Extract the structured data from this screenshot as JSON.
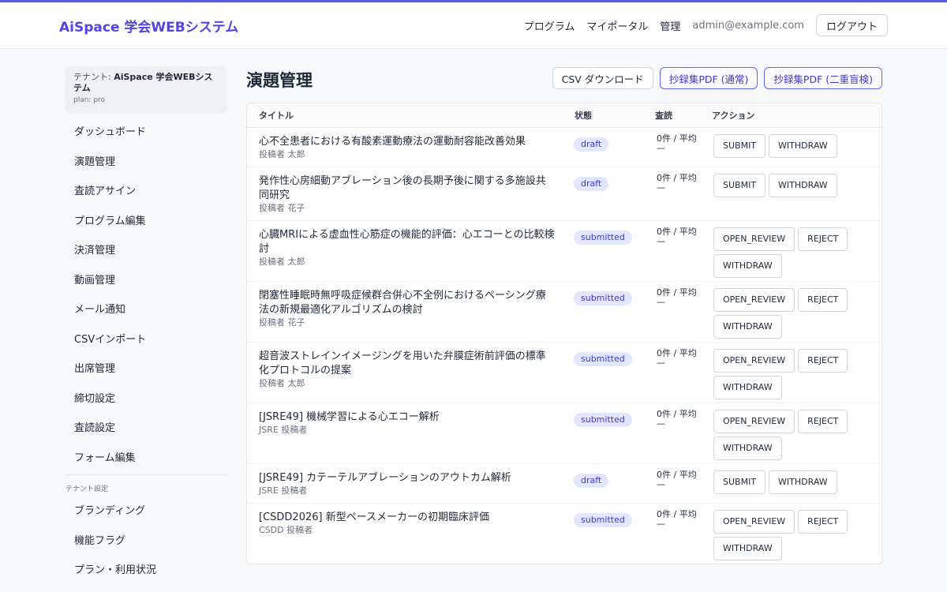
{
  "app": {
    "brand": "AiSpace 学会WEBシステム",
    "accent_color": "#4f46e5"
  },
  "header": {
    "nav": [
      "プログラム",
      "マイポータル",
      "管理"
    ],
    "email": "admin@example.com",
    "logout_label": "ログアウト"
  },
  "sidebar": {
    "tenant_prefix": "テナント: ",
    "tenant_name": "AiSpace 学会WEBシステム",
    "plan": "plan: pro",
    "items": [
      "ダッシュボード",
      "演題管理",
      "査読アサイン",
      "プログラム編集",
      "決済管理",
      "動画管理",
      "メール通知",
      "CSVインポート",
      "出席管理",
      "締切設定",
      "査読設定",
      "フォーム編集"
    ],
    "section_label": "テナント設定",
    "settings_items": [
      "ブランディング",
      "機能フラグ",
      "プラン・利用状況"
    ]
  },
  "main": {
    "title": "演題管理",
    "csv_button": "CSV ダウンロード",
    "pdf_normal_button": "抄録集PDF (通常)",
    "pdf_blind_button": "抄録集PDF (二重盲検)",
    "columns": [
      "タイトル",
      "状態",
      "査読",
      "アクション"
    ],
    "rows": [
      {
        "title": "心不全患者における有酸素運動療法の運動耐容能改善効果",
        "author": "投稿者 太郎",
        "status": "draft",
        "review": "0件 / 平均 —",
        "actions": [
          "SUBMIT",
          "WITHDRAW"
        ]
      },
      {
        "title": "発作性心房細動アブレーション後の長期予後に関する多施設共同研究",
        "author": "投稿者 花子",
        "status": "draft",
        "review": "0件 / 平均 —",
        "actions": [
          "SUBMIT",
          "WITHDRAW"
        ]
      },
      {
        "title": "心臓MRIによる虚血性心筋症の機能的評価：心エコーとの比較検討",
        "author": "投稿者 太郎",
        "status": "submitted",
        "review": "0件 / 平均 —",
        "actions": [
          "OPEN_REVIEW",
          "REJECT",
          "WITHDRAW"
        ]
      },
      {
        "title": "閉塞性睡眠時無呼吸症候群合併心不全例におけるペーシング療法の新規最適化アルゴリズムの検討",
        "author": "投稿者 花子",
        "status": "submitted",
        "review": "0件 / 平均 —",
        "actions": [
          "OPEN_REVIEW",
          "REJECT",
          "WITHDRAW"
        ]
      },
      {
        "title": "超音波ストレインイメージングを用いた弁膜症術前評価の標準化プロトコルの提案",
        "author": "投稿者 太郎",
        "status": "submitted",
        "review": "0件 / 平均 —",
        "actions": [
          "OPEN_REVIEW",
          "REJECT",
          "WITHDRAW"
        ]
      },
      {
        "title": "[JSRE49] 機械学習による心エコー解析",
        "author": "JSRE 投稿者",
        "status": "submitted",
        "review": "0件 / 平均 —",
        "actions": [
          "OPEN_REVIEW",
          "REJECT",
          "WITHDRAW"
        ]
      },
      {
        "title": "[JSRE49] カテーテルアブレーションのアウトカム解析",
        "author": "JSRE 投稿者",
        "status": "draft",
        "review": "0件 / 平均 —",
        "actions": [
          "SUBMIT",
          "WITHDRAW"
        ]
      },
      {
        "title": "[CSDD2026] 新型ペースメーカーの初期臨床評価",
        "author": "CSDD 投稿者",
        "status": "submitted",
        "review": "0件 / 平均 —",
        "actions": [
          "OPEN_REVIEW",
          "REJECT",
          "WITHDRAW"
        ]
      }
    ]
  }
}
